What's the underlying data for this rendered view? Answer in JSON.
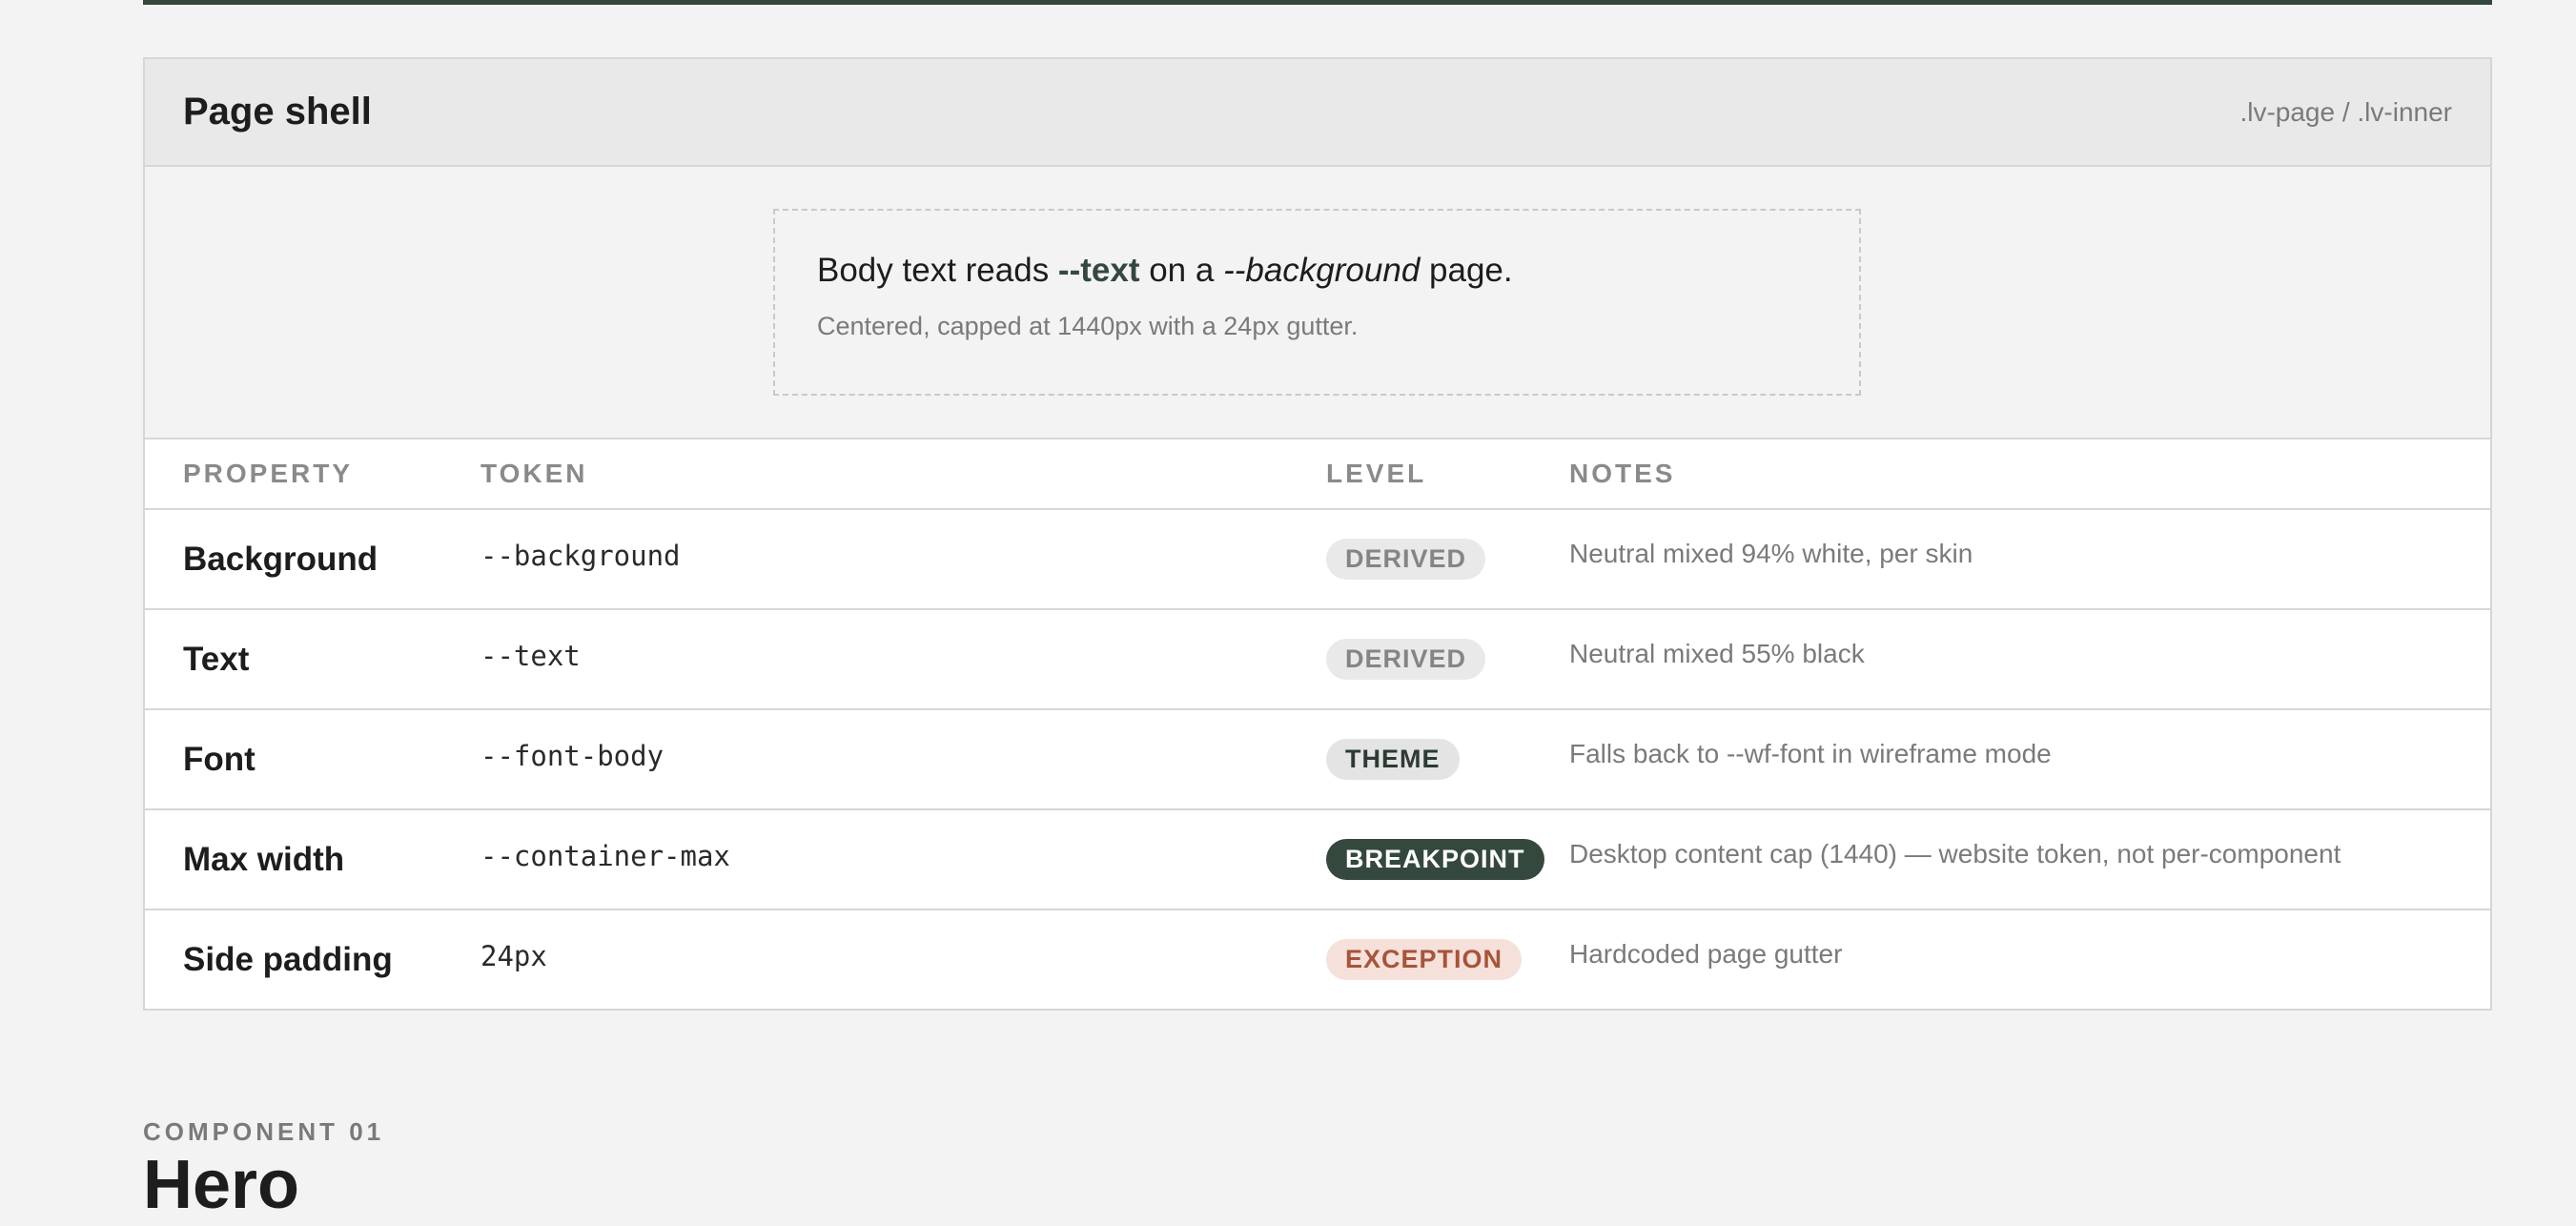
{
  "shell": {
    "title": "Page shell",
    "classes": ".lv-page / .lv-inner",
    "preview": {
      "line_prefix": "Body text reads ",
      "text_token": "--text",
      "line_middle": " on a ",
      "bg_token": "--background",
      "line_suffix": " page.",
      "sub": "Centered, capped at 1440px with a 24px gutter."
    }
  },
  "table": {
    "headers": [
      "PROPERTY",
      "TOKEN",
      "LEVEL",
      "NOTES"
    ],
    "rows": [
      {
        "property": "Background",
        "token": "--background",
        "level": "DERIVED",
        "notes": "Neutral mixed 94% white, per skin"
      },
      {
        "property": "Text",
        "token": "--text",
        "level": "DERIVED",
        "notes": "Neutral mixed 55% black"
      },
      {
        "property": "Font",
        "token": "--font-body",
        "level": "THEME",
        "notes": "Falls back to --wf-font in wireframe mode"
      },
      {
        "property": "Max width",
        "token": "--container-max",
        "level": "BREAKPOINT",
        "notes": "Desktop content cap (1440) — website token, not per-component"
      },
      {
        "property": "Side padding",
        "token": "24px",
        "level": "EXCEPTION",
        "notes": "Hardcoded page gutter"
      }
    ]
  },
  "component": {
    "eyebrow": "COMPONENT 01",
    "title": "Hero"
  },
  "colors": {
    "accent": "#34483e",
    "page_bg": "#f3f3f3",
    "exception_bg": "#f6e0da",
    "exception_text": "#a7543a"
  }
}
